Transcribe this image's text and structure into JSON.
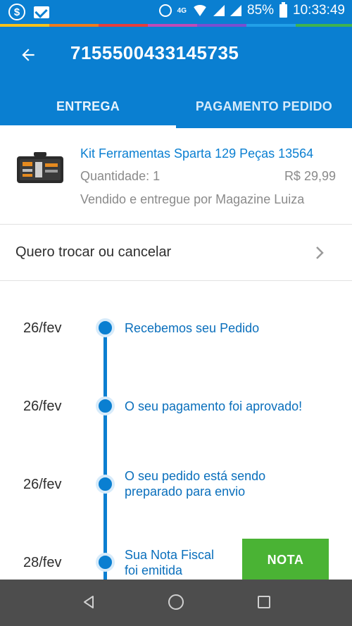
{
  "status_bar": {
    "battery": "85%",
    "time": "10:33:49",
    "network": "4G"
  },
  "header": {
    "order_number": "7155500433145735",
    "tabs": [
      {
        "label": "ENTREGA",
        "active": true
      },
      {
        "label": "PAGAMENTO PEDIDO",
        "active": false
      }
    ]
  },
  "product": {
    "name": "Kit Ferramentas Sparta 129 Peças 13564",
    "quantity": "Quantidade: 1",
    "price": "R$ 29,99",
    "seller": "Vendido e entregue por Magazine Luiza"
  },
  "exchange": {
    "label": "Quero trocar ou cancelar"
  },
  "timeline": {
    "events": [
      {
        "date": "26/fev",
        "text": "Recebemos seu Pedido"
      },
      {
        "date": "26/fev",
        "text": "O seu pagamento foi aprovado!"
      },
      {
        "date": "26/fev",
        "text_line1": "O seu pedido está sendo",
        "text_line2": "preparado para envio"
      },
      {
        "date": "28/fev",
        "text_line1": "Sua Nota Fiscal",
        "text_line2": "foi emitida"
      }
    ],
    "nota_button": "NOTA"
  },
  "colors": {
    "primary": "#0a7fd1",
    "action_green": "#4ab334",
    "nav_bar": "#4d4d4d"
  }
}
